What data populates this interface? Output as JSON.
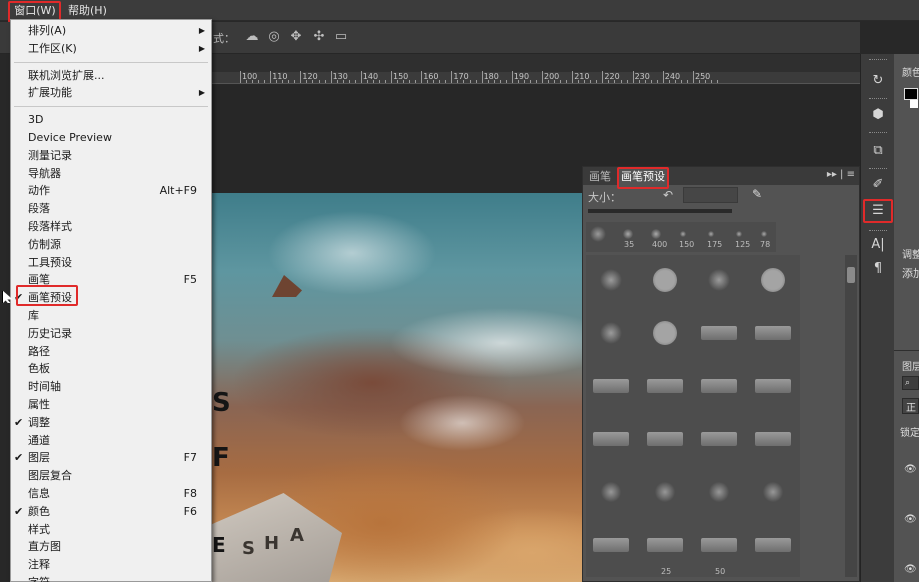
{
  "menubar": {
    "window_label": "窗口(W)",
    "help_label": "帮助(H)"
  },
  "options_bar": {
    "mode_label": "式："
  },
  "ruler": {
    "ticks": [
      "100",
      "110",
      "120",
      "130",
      "140",
      "150",
      "160",
      "170",
      "180",
      "190",
      "200",
      "210",
      "220",
      "230",
      "240",
      "250"
    ]
  },
  "window_menu": {
    "items": [
      {
        "label": "排列(A)",
        "submenu": true
      },
      {
        "label": "工作区(K)",
        "submenu": true
      },
      {
        "label": "联机浏览扩展..."
      },
      {
        "label": "扩展功能",
        "submenu": true
      },
      {
        "label": "3D"
      },
      {
        "label": "Device Preview"
      },
      {
        "label": "测量记录"
      },
      {
        "label": "导航器"
      },
      {
        "label": "动作",
        "shortcut": "Alt+F9"
      },
      {
        "label": "段落"
      },
      {
        "label": "段落样式"
      },
      {
        "label": "仿制源"
      },
      {
        "label": "工具预设"
      },
      {
        "label": "画笔",
        "shortcut": "F5"
      },
      {
        "label": "画笔预设",
        "checked": true
      },
      {
        "label": "库"
      },
      {
        "label": "历史记录"
      },
      {
        "label": "路径"
      },
      {
        "label": "色板"
      },
      {
        "label": "时间轴"
      },
      {
        "label": "属性"
      },
      {
        "label": "调整",
        "checked": true
      },
      {
        "label": "通道"
      },
      {
        "label": "图层",
        "checked": true,
        "shortcut": "F7"
      },
      {
        "label": "图层复合"
      },
      {
        "label": "信息",
        "shortcut": "F8"
      },
      {
        "label": "颜色",
        "checked": true,
        "shortcut": "F6"
      },
      {
        "label": "样式"
      },
      {
        "label": "直方图"
      },
      {
        "label": "注释"
      },
      {
        "label": "字符"
      }
    ],
    "check_glyph": "✔",
    "arrow_glyph": "▶"
  },
  "brush_panel": {
    "tab_brush": "画笔",
    "tab_preset": "画笔预设",
    "size_label": "大小：",
    "recent_sizes": [
      "35",
      "400",
      "150",
      "175",
      "125",
      "78"
    ],
    "grid_numbers": [
      "25",
      "50"
    ],
    "header_controls": "▸▸ | ≡"
  },
  "right_strip": {
    "icons": [
      "history-icon",
      "3d-icon",
      "clone-source-icon",
      "brush-icon",
      "brush-preset-icon",
      "character-icon",
      "paragraph-icon"
    ]
  },
  "far_right": {
    "color_label": "颜色",
    "adjust_label": "调整",
    "adjust_add_label": "添加",
    "layers_label": "图层",
    "normal_label": "正常",
    "lock_label": "锁定"
  },
  "photo": {
    "lettering": [
      "S",
      "F",
      "E",
      "S",
      "H",
      "A"
    ]
  }
}
